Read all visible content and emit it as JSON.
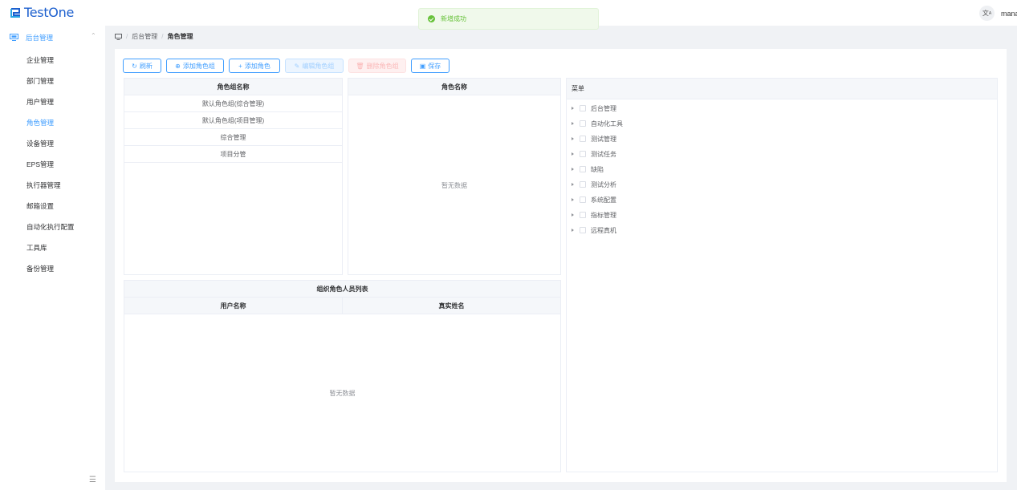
{
  "app": {
    "logo_text": "TestOne",
    "user_name": "mana",
    "translate_icon": "translate-icon"
  },
  "toast": {
    "message": "新增成功",
    "type": "success"
  },
  "sidebar": {
    "parent": {
      "label": "后台管理",
      "icon": "monitor-icon",
      "expanded": true
    },
    "items": [
      {
        "label": "企业管理"
      },
      {
        "label": "部门管理"
      },
      {
        "label": "用户管理"
      },
      {
        "label": "角色管理",
        "active": true
      },
      {
        "label": "设备管理"
      },
      {
        "label": "EPS管理"
      },
      {
        "label": "执行器管理"
      },
      {
        "label": "邮箱设置"
      },
      {
        "label": "自动化执行配置"
      },
      {
        "label": "工具库"
      },
      {
        "label": "备份管理"
      }
    ]
  },
  "breadcrumb": {
    "items": [
      "后台管理",
      "角色管理"
    ]
  },
  "toolbar": {
    "refresh": "刷新",
    "add_group": "添加角色组",
    "add_role": "添加角色",
    "edit_group": "编辑角色组",
    "delete_group": "删除角色组",
    "save": "保存"
  },
  "role_groups": {
    "header": "角色组名称",
    "rows": [
      "默认角色组(综合管理)",
      "默认角色组(项目管理)",
      "综合管理",
      "项目分管"
    ]
  },
  "roles": {
    "header": "角色名称",
    "empty_text": "暂无数据"
  },
  "members": {
    "title": "组织角色人员列表",
    "columns": [
      "用户名称",
      "真实姓名"
    ],
    "empty_text": "暂无数据"
  },
  "menu_tree": {
    "header": "菜单",
    "nodes": [
      "后台管理",
      "自动化工具",
      "测试管理",
      "测试任务",
      "缺陷",
      "测试分析",
      "系统配置",
      "指标管理",
      "远程真机"
    ]
  },
  "colors": {
    "primary": "#409eff",
    "success": "#67c23a",
    "danger": "#f56c6c",
    "logo": "#1c5fce"
  }
}
